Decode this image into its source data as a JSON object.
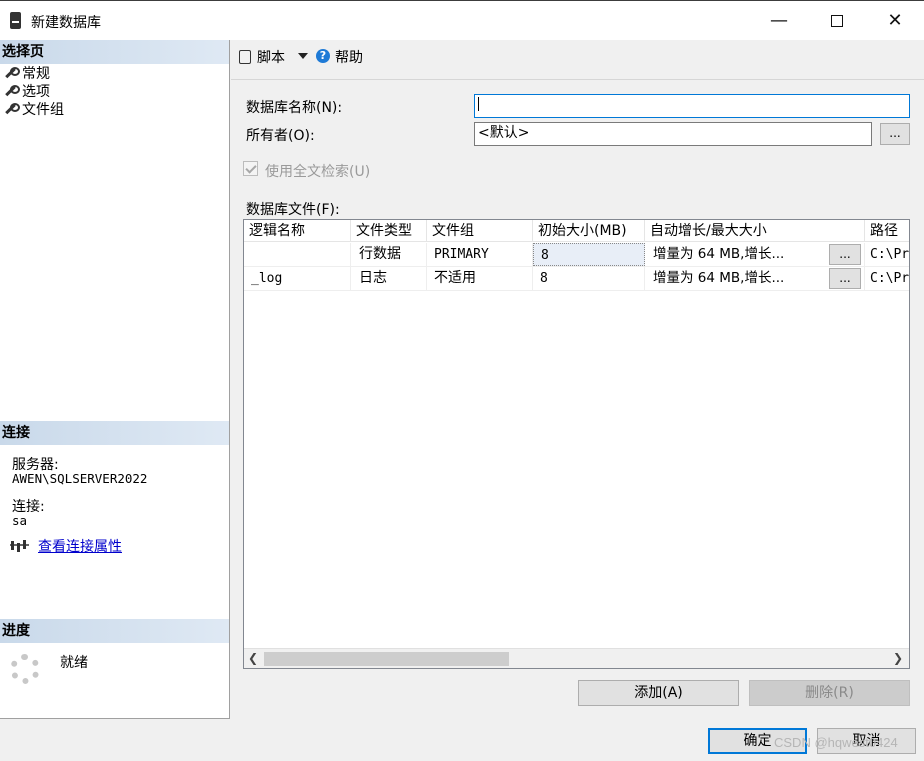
{
  "window": {
    "title": "新建数据库",
    "minimize_glyph": "—",
    "close_glyph": "✕"
  },
  "left_panel": {
    "select_page": {
      "header": "选择页",
      "items": [
        {
          "label": "常规",
          "icon": "wrench-icon"
        },
        {
          "label": "选项",
          "icon": "wrench-icon"
        },
        {
          "label": "文件组",
          "icon": "wrench-icon"
        }
      ]
    },
    "connection": {
      "header": "连接",
      "server_label": "服务器:",
      "server_value": "AWEN\\SQLSERVER2022",
      "conn_label": "连接:",
      "conn_value": "sa",
      "view_link": "查看连接属性"
    },
    "progress": {
      "header": "进度",
      "status": "就绪"
    }
  },
  "toolbar": {
    "script_label": "脚本",
    "help_label": "帮助"
  },
  "form": {
    "db_name_label": "数据库名称(N):",
    "db_name_value": "",
    "owner_label": "所有者(O):",
    "owner_value": "<默认>",
    "owner_browse": "...",
    "fulltext_label": "使用全文检索(U)",
    "fulltext_checked": true,
    "fulltext_enabled": false,
    "files_label": "数据库文件(F):"
  },
  "files_table": {
    "columns": [
      "逻辑名称",
      "文件类型",
      "文件组",
      "初始大小(MB)",
      "自动增长/最大大小",
      "路径"
    ],
    "rows": [
      {
        "logical_name": "",
        "file_type": "行数据",
        "filegroup": "PRIMARY",
        "initial_size": "8",
        "autogrowth": "增量为 64 MB,增长...",
        "path": "C:\\Pr"
      },
      {
        "logical_name": "_log",
        "file_type": "日志",
        "filegroup": "不适用",
        "initial_size": "8",
        "autogrowth": "增量为 64 MB,增长...",
        "path": "C:\\Pr"
      }
    ],
    "browse_label": "..."
  },
  "buttons": {
    "add": "添加(A)",
    "remove": "删除(R)",
    "ok": "确定",
    "cancel": "取消"
  },
  "watermark": "CSDN @hqwest0424",
  "colors": {
    "section_header": "#c9d9ea",
    "link": "#0000cc",
    "focus_border": "#0078d7",
    "help_icon": "#1e7ad6"
  }
}
